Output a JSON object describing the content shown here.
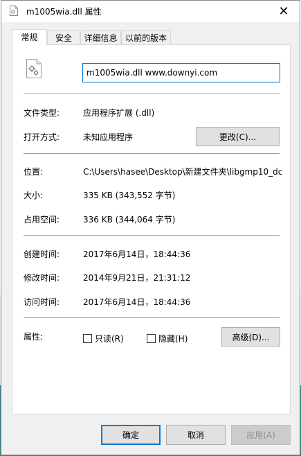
{
  "window": {
    "title": "m1005wia.dll 属性",
    "close_glyph": "✕"
  },
  "tabs": [
    {
      "label": "常规",
      "active": true
    },
    {
      "label": "安全"
    },
    {
      "label": "详细信息"
    },
    {
      "label": "以前的版本"
    }
  ],
  "general": {
    "file_name": "m1005wia.dll www.downyi.com",
    "type_label": "文件类型:",
    "type_value": "应用程序扩展 (.dll)",
    "opens_label": "打开方式:",
    "opens_value": "未知应用程序",
    "change_button": "更改(C)...",
    "location_label": "位置:",
    "location_value": "C:\\Users\\hasee\\Desktop\\新建文件夹\\libgmp10_dc",
    "size_label": "大小:",
    "size_value": "335 KB (343,552 字节)",
    "disk_label": "占用空间:",
    "disk_value": "336 KB (344,064 字节)",
    "created_label": "创建时间:",
    "created_value": "2017年6月14日，18:44:36",
    "modified_label": "修改时间:",
    "modified_value": "2014年9月21日，21:31:12",
    "accessed_label": "访问时间:",
    "accessed_value": "2017年6月14日，18:44:36",
    "attributes_label": "属性:",
    "readonly_label": "只读(R)",
    "hidden_label": "隐藏(H)",
    "advanced_button": "高级(D)..."
  },
  "footer": {
    "ok": "确定",
    "cancel": "取消",
    "apply": "应用(A)"
  },
  "colors": {
    "accent": "#0078d7",
    "dialog_bg": "#f0f0f0",
    "panel_bg": "#ffffff",
    "separator": "#a0a0a0"
  },
  "icons": {
    "title": "dll-file-icon",
    "file": "dll-file-gear-icon"
  }
}
